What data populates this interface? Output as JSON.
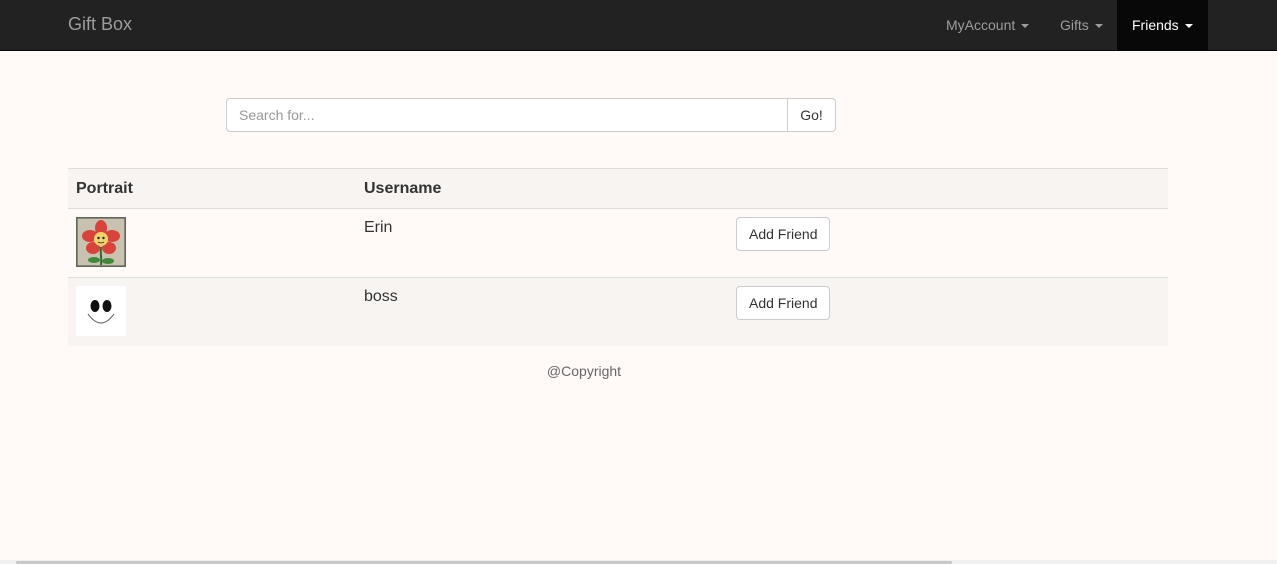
{
  "navbar": {
    "brand": "Gift Box",
    "items": [
      {
        "label": "MyAccount",
        "active": false
      },
      {
        "label": "Gifts",
        "active": false
      },
      {
        "label": "Friends",
        "active": true
      }
    ]
  },
  "search": {
    "placeholder": "Search for...",
    "value": "",
    "button_label": "Go!"
  },
  "table": {
    "headers": [
      "Portrait",
      "Username",
      ""
    ],
    "rows": [
      {
        "portrait_icon": "flower-portrait-icon",
        "username": "Erin",
        "action_label": "Add Friend"
      },
      {
        "portrait_icon": "smiley-face-portrait-icon",
        "username": "boss",
        "action_label": "Add Friend"
      }
    ]
  },
  "footer": {
    "text": "@Copyright"
  },
  "colors": {
    "navbar_bg": "#222222",
    "navbar_active_bg": "#080808",
    "page_bg": "#fffaf7",
    "striped_row_bg": "#f7f4f2"
  }
}
